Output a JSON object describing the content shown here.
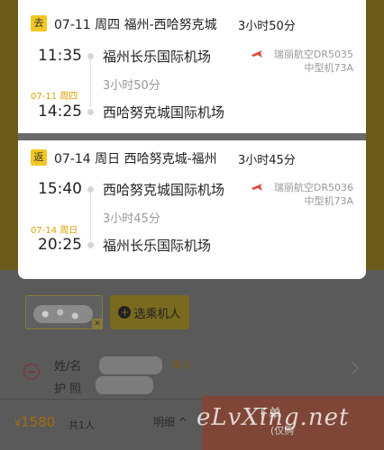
{
  "outbound": {
    "tag": "去",
    "date_header": "07-11 周四 福州-西哈努克城",
    "duration_header": "3小时50分",
    "dep_time": "11:35",
    "dep_airport": "福州长乐国际机场",
    "airline_line1": "瑞丽航空DR5035",
    "airline_line2": "中型机73A",
    "mid_duration": "3小时50分",
    "arr_small_date": "07-11 周四",
    "arr_time": "14:25",
    "arr_airport": "西哈努克城国际机场"
  },
  "return": {
    "tag": "返",
    "date_header": "07-14 周日 西哈努克城-福州",
    "duration_header": "3小时45分",
    "dep_time": "15:40",
    "dep_airport": "西哈努克城国际机场",
    "airline_line1": "瑞丽航空DR5036",
    "airline_line2": "中型机73A",
    "mid_duration": "3小时45分",
    "arr_small_date": "07-14 周日",
    "arr_time": "20:25",
    "arr_airport": "福州长乐国际机场"
  },
  "passenger": {
    "add_label": "选乘机人",
    "name_label": "姓/名",
    "self_label": "本人",
    "id_label": "护 照"
  },
  "bottom": {
    "currency": "¥",
    "price": "1580",
    "count": "共1人",
    "detail": "明细",
    "submit": "下单",
    "submit_sub": "(仅购"
  },
  "watermark": "eLvXing.net",
  "colors": {
    "tag": "#f3c623",
    "accent": "#e0a100",
    "submit": "#7f4637"
  }
}
